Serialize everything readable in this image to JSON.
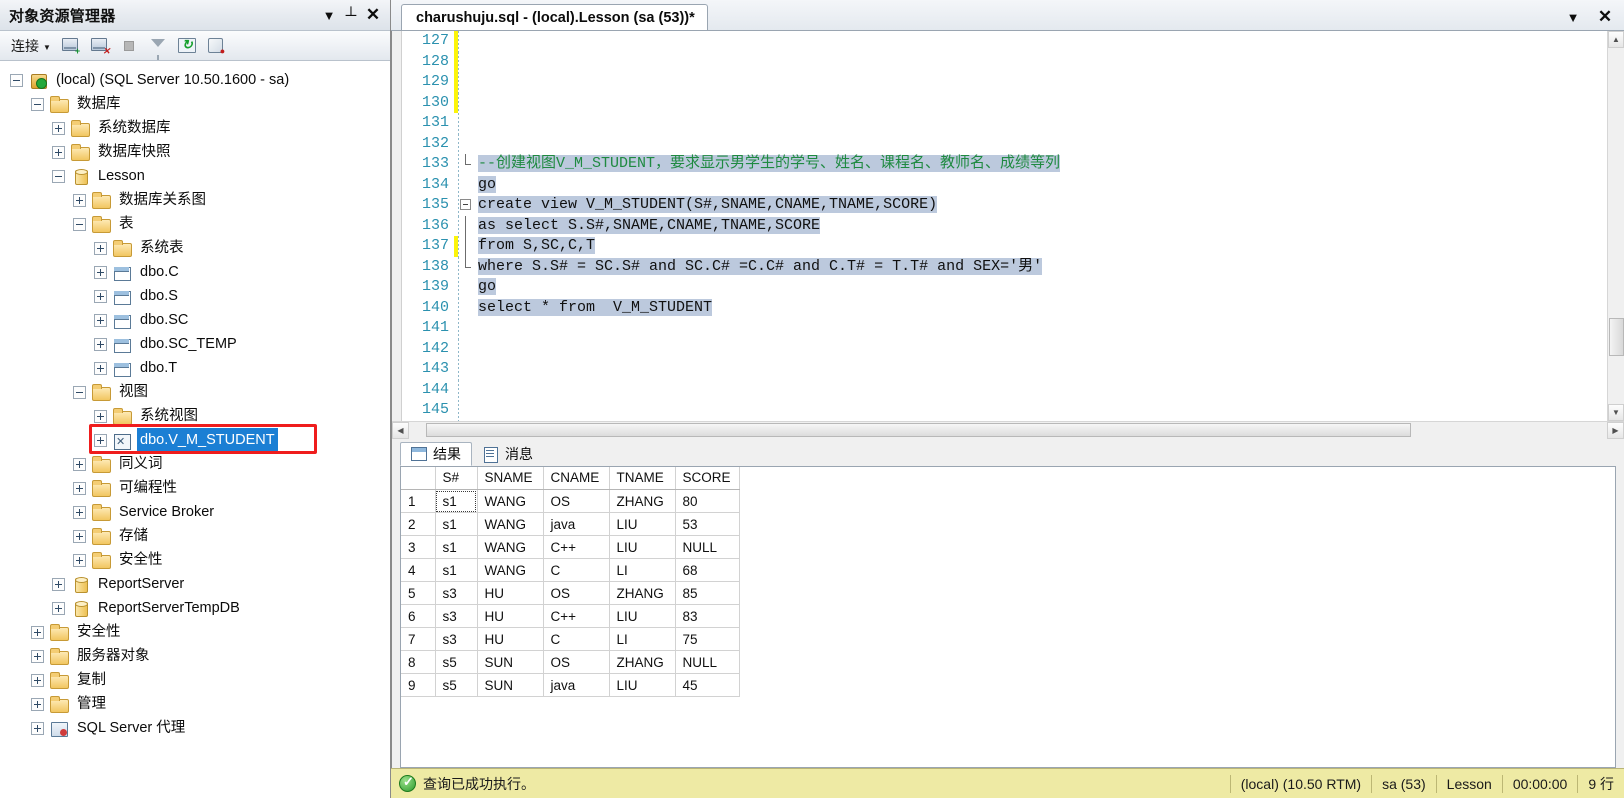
{
  "object_explorer": {
    "title": "对象资源管理器",
    "caption_buttons": [
      {
        "name": "dropdown",
        "glyph": "▼"
      },
      {
        "name": "pin",
        "glyph": "⇲"
      },
      {
        "name": "close",
        "glyph": "✕"
      }
    ],
    "toolbar": {
      "connect_label": "连接",
      "connect_arrow": "▼",
      "icons": [
        "connect-server-icon",
        "disconnect-server-icon",
        "stop-icon",
        "filter-icon",
        "refresh-icon",
        "script-icon"
      ]
    },
    "tree": [
      {
        "indent": 0,
        "expander": "minus",
        "icon": "server",
        "label": "(local) (SQL Server 10.50.1600 - sa)",
        "selected": false
      },
      {
        "indent": 1,
        "expander": "minus",
        "icon": "folder",
        "label": "数据库",
        "selected": false
      },
      {
        "indent": 2,
        "expander": "plus",
        "icon": "folder",
        "label": "系统数据库",
        "selected": false
      },
      {
        "indent": 2,
        "expander": "plus",
        "icon": "folder",
        "label": "数据库快照",
        "selected": false
      },
      {
        "indent": 2,
        "expander": "minus",
        "icon": "db",
        "label": "Lesson",
        "selected": false
      },
      {
        "indent": 3,
        "expander": "plus",
        "icon": "folder",
        "label": "数据库关系图",
        "selected": false
      },
      {
        "indent": 3,
        "expander": "minus",
        "icon": "folder",
        "label": "表",
        "selected": false
      },
      {
        "indent": 4,
        "expander": "plus",
        "icon": "folder",
        "label": "系统表",
        "selected": false
      },
      {
        "indent": 4,
        "expander": "plus",
        "icon": "table",
        "label": "dbo.C",
        "selected": false
      },
      {
        "indent": 4,
        "expander": "plus",
        "icon": "table",
        "label": "dbo.S",
        "selected": false
      },
      {
        "indent": 4,
        "expander": "plus",
        "icon": "table",
        "label": "dbo.SC",
        "selected": false
      },
      {
        "indent": 4,
        "expander": "plus",
        "icon": "table",
        "label": "dbo.SC_TEMP",
        "selected": false
      },
      {
        "indent": 4,
        "expander": "plus",
        "icon": "table",
        "label": "dbo.T",
        "selected": false
      },
      {
        "indent": 3,
        "expander": "minus",
        "icon": "folder",
        "label": "视图",
        "selected": false
      },
      {
        "indent": 4,
        "expander": "plus",
        "icon": "folder",
        "label": "系统视图",
        "selected": false
      },
      {
        "indent": 4,
        "expander": "plus",
        "icon": "view",
        "label": "dbo.V_M_STUDENT",
        "selected": true
      },
      {
        "indent": 3,
        "expander": "plus",
        "icon": "folder",
        "label": "同义词",
        "selected": false
      },
      {
        "indent": 3,
        "expander": "plus",
        "icon": "folder",
        "label": "可编程性",
        "selected": false
      },
      {
        "indent": 3,
        "expander": "plus",
        "icon": "folder",
        "label": "Service Broker",
        "selected": false
      },
      {
        "indent": 3,
        "expander": "plus",
        "icon": "folder",
        "label": "存储",
        "selected": false
      },
      {
        "indent": 3,
        "expander": "plus",
        "icon": "folder",
        "label": "安全性",
        "selected": false
      },
      {
        "indent": 2,
        "expander": "plus",
        "icon": "db",
        "label": "ReportServer",
        "selected": false
      },
      {
        "indent": 2,
        "expander": "plus",
        "icon": "db",
        "label": "ReportServerTempDB",
        "selected": false
      },
      {
        "indent": 1,
        "expander": "plus",
        "icon": "folder",
        "label": "安全性",
        "selected": false
      },
      {
        "indent": 1,
        "expander": "plus",
        "icon": "folder",
        "label": "服务器对象",
        "selected": false
      },
      {
        "indent": 1,
        "expander": "plus",
        "icon": "folder",
        "label": "复制",
        "selected": false
      },
      {
        "indent": 1,
        "expander": "plus",
        "icon": "folder",
        "label": "管理",
        "selected": false
      },
      {
        "indent": 1,
        "expander": "plus",
        "icon": "agent",
        "label": "SQL Server 代理",
        "selected": false
      }
    ]
  },
  "editor": {
    "tab_title": "charushuju.sql - (local).Lesson (sa (53))*",
    "caption_buttons": [
      {
        "name": "dropdown",
        "glyph": "▼"
      },
      {
        "name": "close",
        "glyph": "✕"
      }
    ],
    "lines": [
      {
        "num": "127",
        "changed": true,
        "fold": "none",
        "segments": []
      },
      {
        "num": "128",
        "changed": true,
        "fold": "none",
        "segments": []
      },
      {
        "num": "129",
        "changed": true,
        "fold": "none",
        "segments": []
      },
      {
        "num": "130",
        "changed": true,
        "fold": "none",
        "segments": []
      },
      {
        "num": "131",
        "changed": false,
        "fold": "none",
        "segments": []
      },
      {
        "num": "132",
        "changed": false,
        "fold": "none",
        "segments": []
      },
      {
        "num": "133",
        "changed": false,
        "fold": "elbow",
        "segments": [
          {
            "cls": "cm sel",
            "text": "--创建视图V_M_STUDENT，要求显示男学生的学号、姓名、课程名、教师名、成绩等列"
          }
        ]
      },
      {
        "num": "134",
        "changed": false,
        "fold": "none",
        "segments": [
          {
            "cls": "txt sel",
            "text": "go"
          }
        ]
      },
      {
        "num": "135",
        "changed": false,
        "fold": "box",
        "segments": [
          {
            "cls": "txt sel",
            "text": "create view V_M_STUDENT(S#,SNAME,CNAME,TNAME,SCORE)"
          }
        ]
      },
      {
        "num": "136",
        "changed": false,
        "fold": "vline",
        "segments": [
          {
            "cls": "txt sel",
            "text": "as select S.S#,SNAME,CNAME,TNAME,SCORE"
          }
        ]
      },
      {
        "num": "137",
        "changed": true,
        "fold": "vline",
        "segments": [
          {
            "cls": "txt sel",
            "text": "from S,SC,C,T"
          }
        ]
      },
      {
        "num": "138",
        "changed": false,
        "fold": "elbow",
        "segments": [
          {
            "cls": "txt sel",
            "text": "where S.S# = SC.S# and SC.C# =C.C# and C.T# = T.T# and SEX='男'"
          }
        ]
      },
      {
        "num": "139",
        "changed": false,
        "fold": "none",
        "segments": [
          {
            "cls": "txt sel",
            "text": "go"
          }
        ]
      },
      {
        "num": "140",
        "changed": false,
        "fold": "none",
        "segments": [
          {
            "cls": "txt sel",
            "text": "select * from  V_M_STUDENT"
          }
        ]
      },
      {
        "num": "141",
        "changed": false,
        "fold": "none",
        "segments": []
      },
      {
        "num": "142",
        "changed": false,
        "fold": "none",
        "segments": []
      },
      {
        "num": "143",
        "changed": false,
        "fold": "none",
        "segments": []
      },
      {
        "num": "144",
        "changed": false,
        "fold": "none",
        "segments": []
      },
      {
        "num": "145",
        "changed": false,
        "fold": "none",
        "segments": []
      }
    ]
  },
  "results": {
    "tabs": [
      {
        "label": "结果",
        "icon": "grid-icon",
        "active": true
      },
      {
        "label": "消息",
        "icon": "message-icon",
        "active": false
      }
    ],
    "columns": [
      "",
      "S#",
      "SNAME",
      "CNAME",
      "TNAME",
      "SCORE"
    ],
    "rows": [
      {
        "n": "1",
        "S#": "s1",
        "SNAME": "WANG",
        "CNAME": "OS",
        "TNAME": "ZHANG",
        "SCORE": "80"
      },
      {
        "n": "2",
        "S#": "s1",
        "SNAME": "WANG",
        "CNAME": "java",
        "TNAME": "LIU",
        "SCORE": "53"
      },
      {
        "n": "3",
        "S#": "s1",
        "SNAME": "WANG",
        "CNAME": "C++",
        "TNAME": "LIU",
        "SCORE": "NULL"
      },
      {
        "n": "4",
        "S#": "s1",
        "SNAME": "WANG",
        "CNAME": "C",
        "TNAME": "LI",
        "SCORE": "68"
      },
      {
        "n": "5",
        "S#": "s3",
        "SNAME": "HU",
        "CNAME": "OS",
        "TNAME": "ZHANG",
        "SCORE": "85"
      },
      {
        "n": "6",
        "S#": "s3",
        "SNAME": "HU",
        "CNAME": "C++",
        "TNAME": "LIU",
        "SCORE": "83"
      },
      {
        "n": "7",
        "S#": "s3",
        "SNAME": "HU",
        "CNAME": "C",
        "TNAME": "LI",
        "SCORE": "75"
      },
      {
        "n": "8",
        "S#": "s5",
        "SNAME": "SUN",
        "CNAME": "OS",
        "TNAME": "ZHANG",
        "SCORE": "NULL"
      },
      {
        "n": "9",
        "S#": "s5",
        "SNAME": "SUN",
        "CNAME": "java",
        "TNAME": "LIU",
        "SCORE": "45"
      }
    ]
  },
  "statusbar": {
    "message": "查询已成功执行。",
    "server": "(local) (10.50 RTM)",
    "user": "sa (53)",
    "database": "Lesson",
    "elapsed": "00:00:00",
    "rowcount": "9 行"
  },
  "colors": {
    "selection": "#bcc9dd",
    "tree_selection": "#1b7fd4",
    "highlight_box": "#ef1d1d",
    "comment": "#1f8a41",
    "linenumber": "#2b91af",
    "null_cell": "#fbf8d8",
    "statusbar": "#eeeaa4",
    "changebar": "#fcf40a"
  }
}
